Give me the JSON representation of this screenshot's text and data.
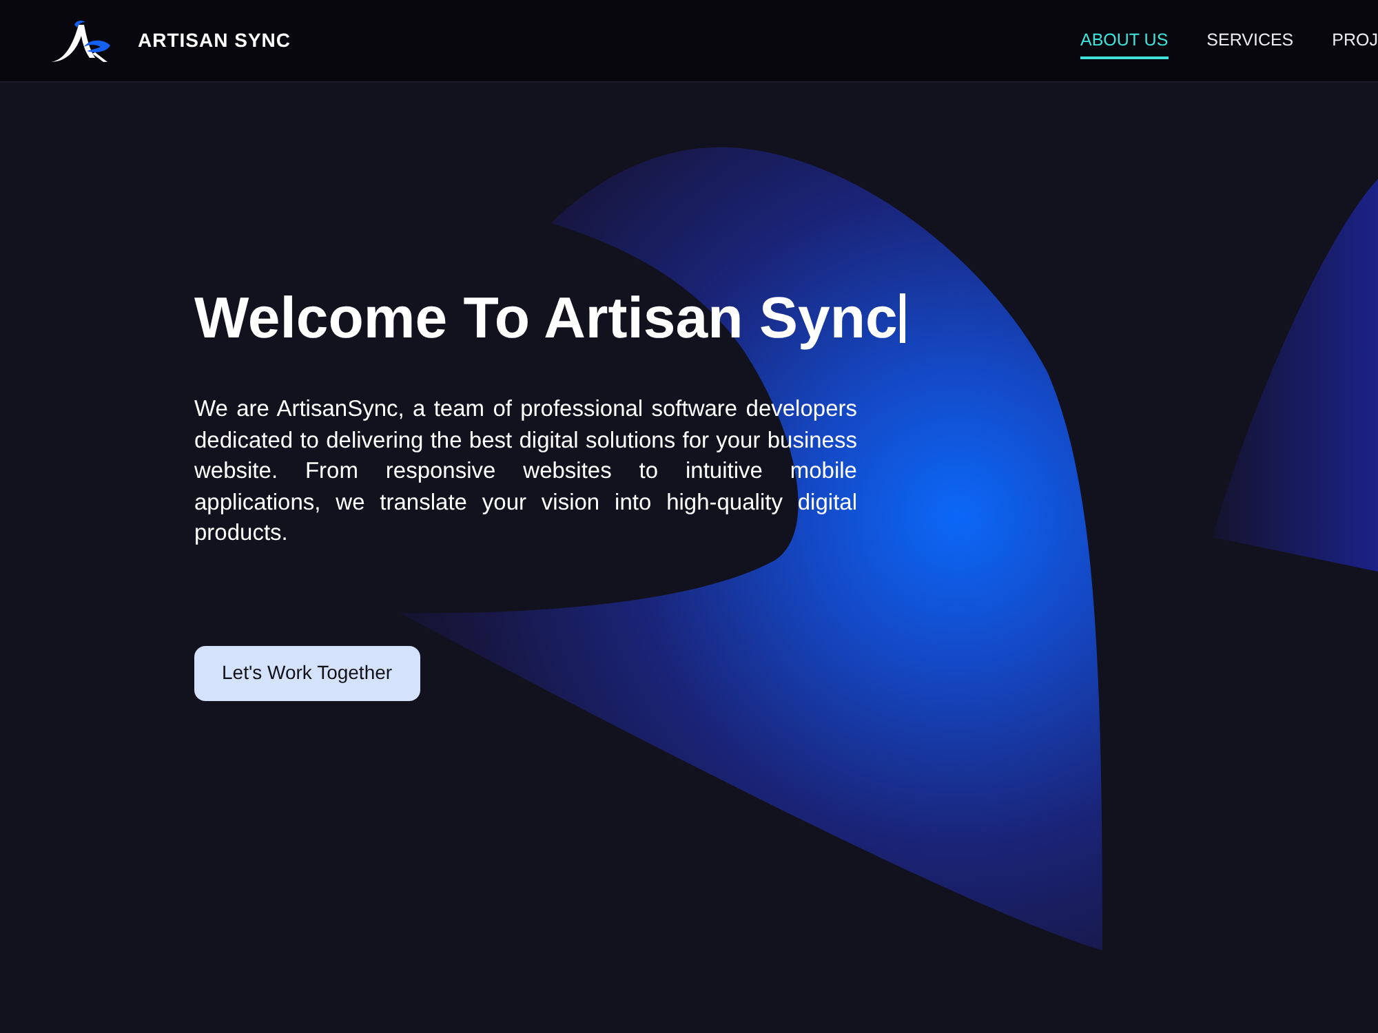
{
  "header": {
    "brand": "ARTISAN SYNC",
    "nav": [
      {
        "label": "ABOUT US",
        "selected": true
      },
      {
        "label": "SERVICES",
        "selected": false
      },
      {
        "label": "PROJ",
        "selected": false
      }
    ]
  },
  "hero": {
    "heading": "Welcome To Artisan Sync",
    "caret": true,
    "text": "We are ArtisanSync, a team of professional software developers dedicated to delivering the best digital solutions for your business website. From responsive websites to intuitive mobile applications, we translate your vision into high-quality digital products.",
    "button": "Let's Work Together"
  }
}
